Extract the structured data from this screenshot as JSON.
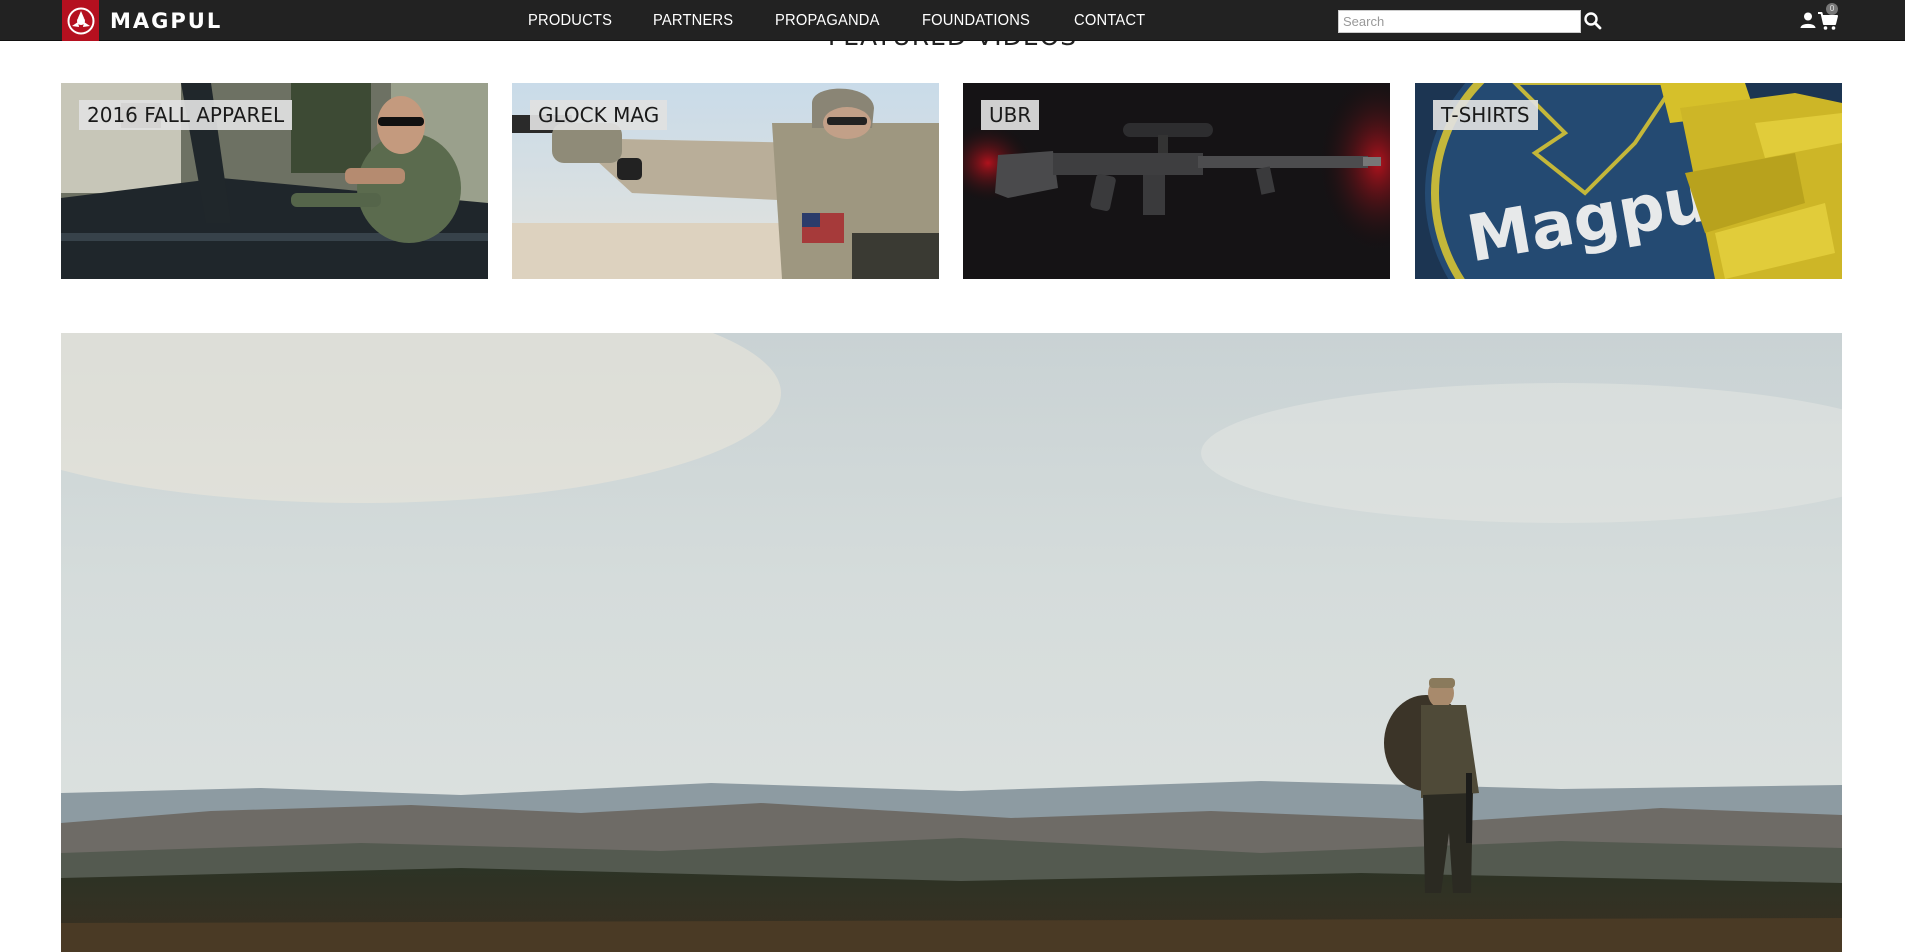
{
  "header": {
    "brand": "MAGPUL",
    "nav": [
      {
        "label": "PRODUCTS"
      },
      {
        "label": "PARTNERS"
      },
      {
        "label": "PROPAGANDA"
      },
      {
        "label": "FOUNDATIONS"
      },
      {
        "label": "CONTACT"
      }
    ],
    "search": {
      "placeholder": "Search",
      "value": ""
    },
    "cart_count": "0",
    "icons": [
      "magpul-logo-icon",
      "search-icon",
      "user-icon",
      "cart-icon"
    ]
  },
  "featured": {
    "heading": "FEATURED VIDEOS",
    "tiles": [
      {
        "label": "2016 FALL APPAREL"
      },
      {
        "label": "GLOCK MAG"
      },
      {
        "label": "UBR"
      },
      {
        "label": "T-SHIRTS"
      }
    ]
  },
  "colors": {
    "nav_bg": "#222222",
    "brand_red": "#b5101f",
    "label_bg": "#e1e1e1"
  }
}
